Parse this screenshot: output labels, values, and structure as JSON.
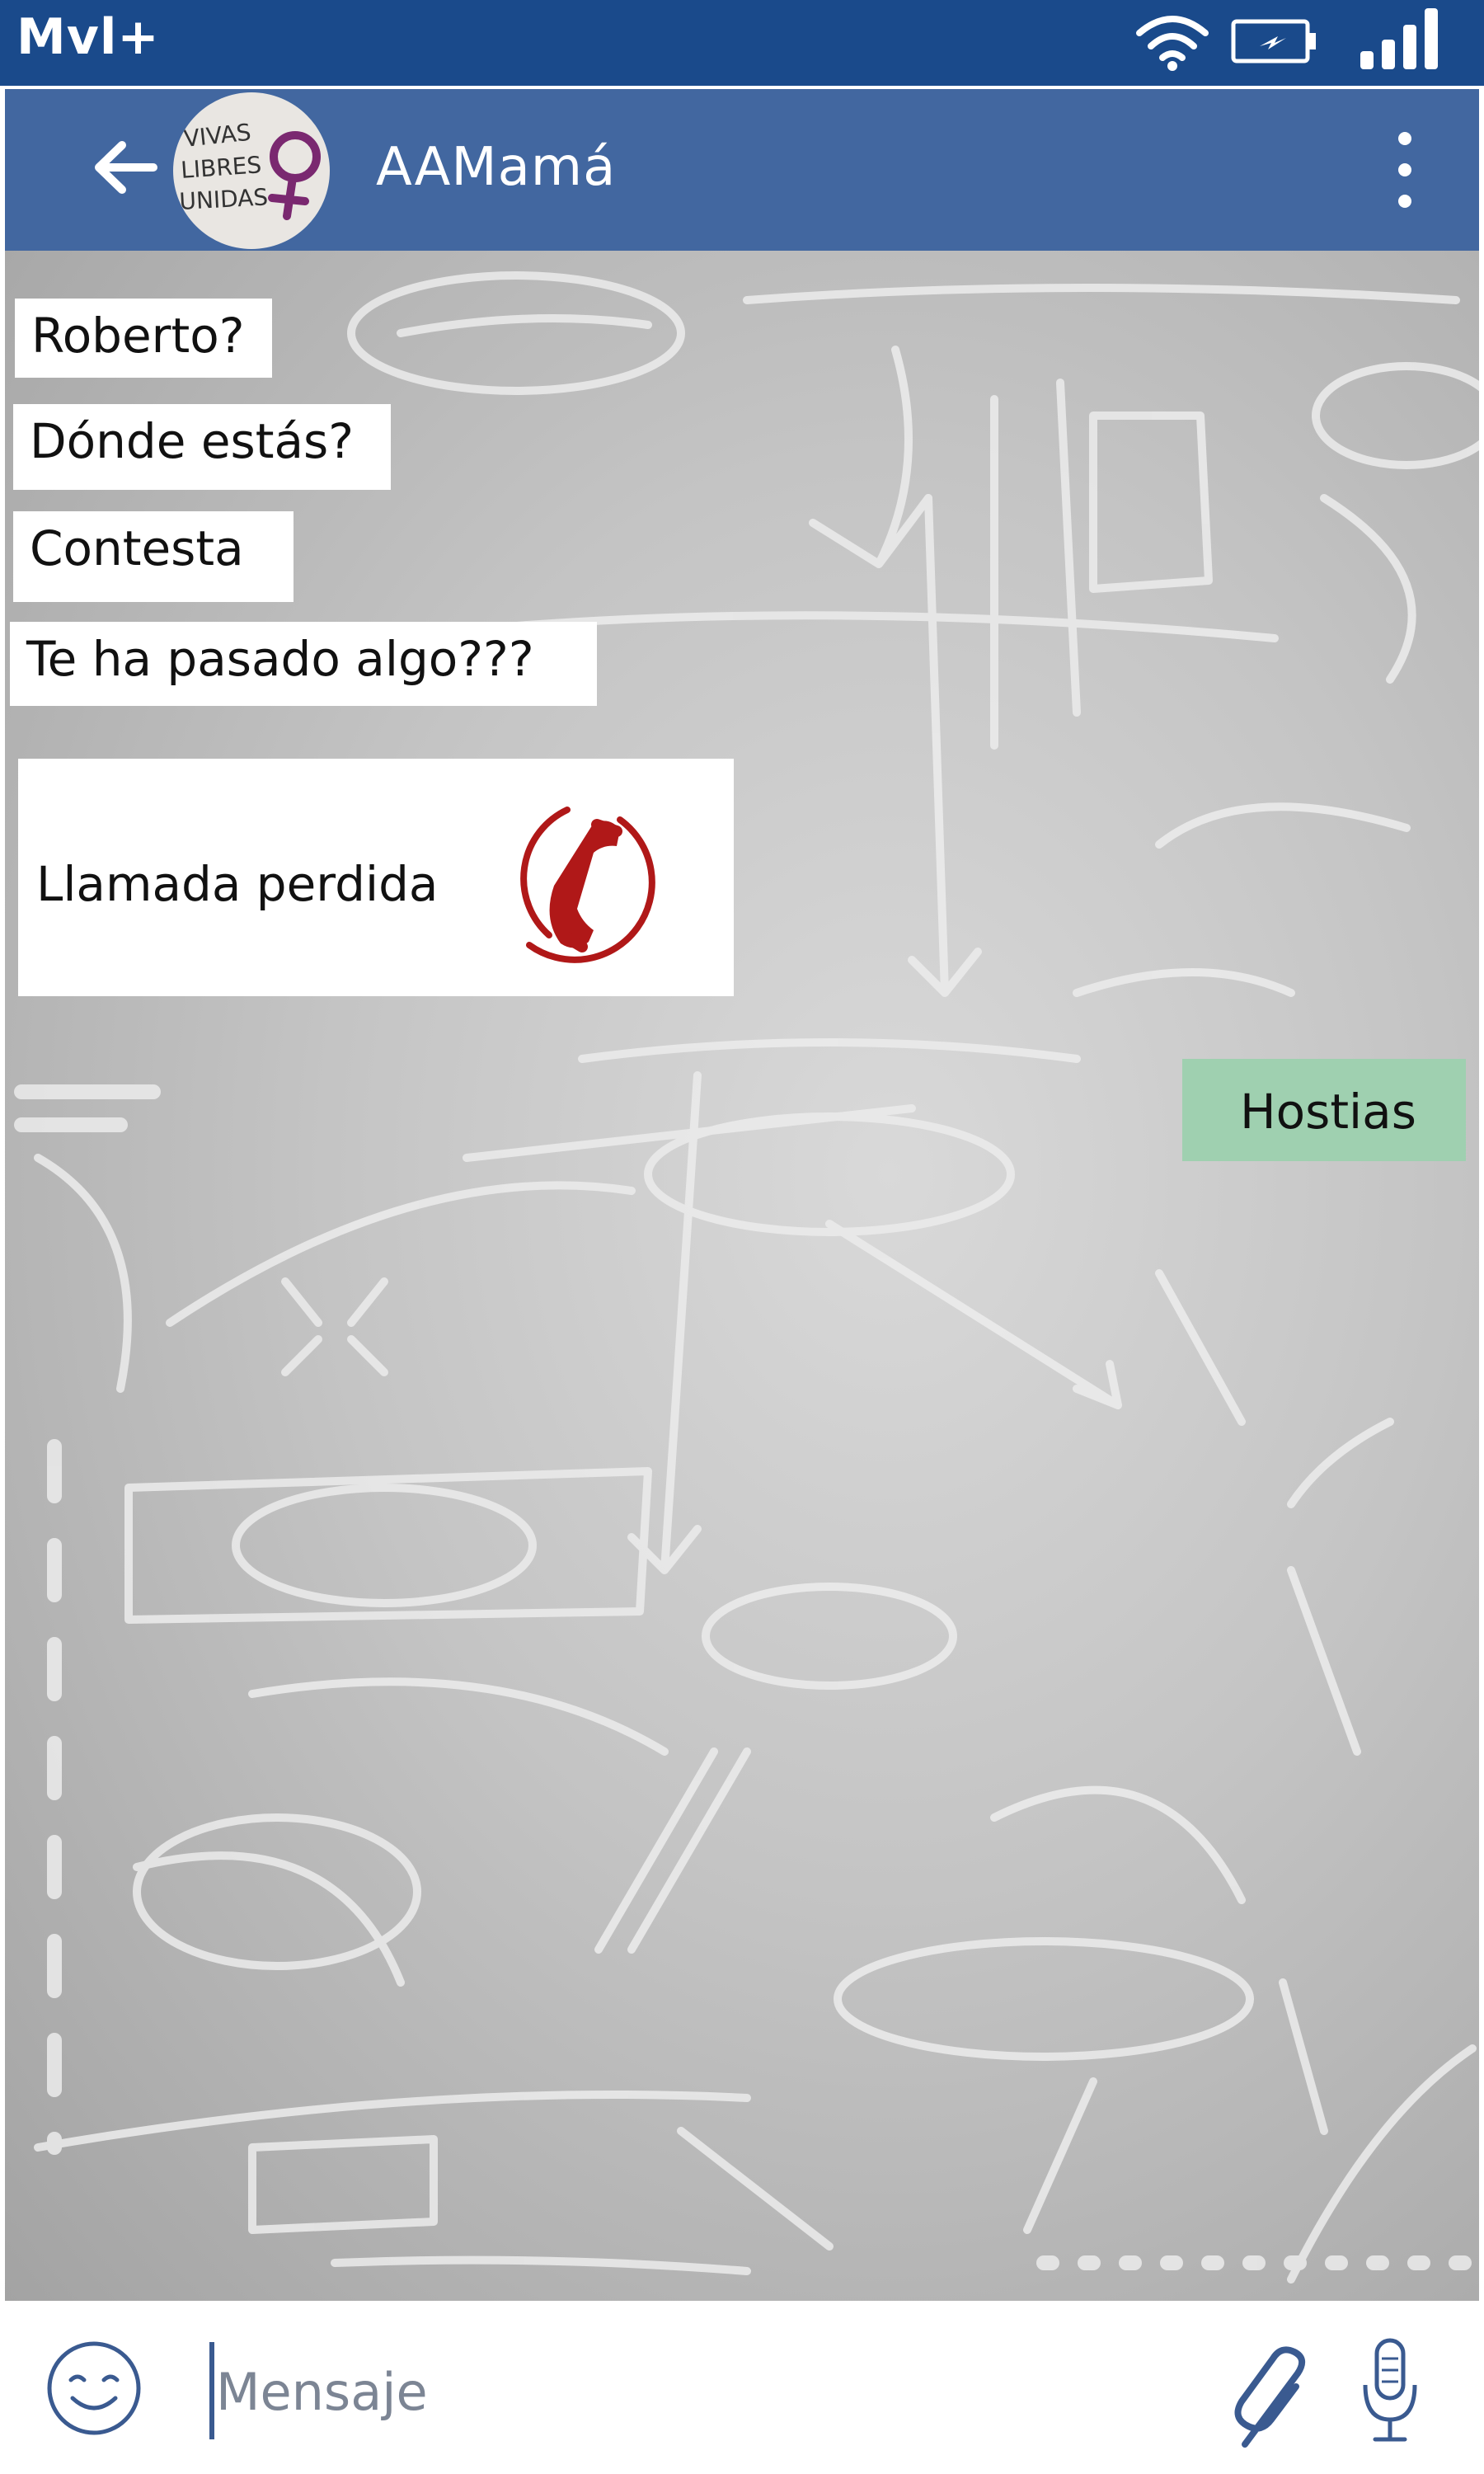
{
  "status_bar": {
    "carrier": "Mvl+",
    "icons": [
      "wifi-icon",
      "battery-charging-icon",
      "signal-icon"
    ]
  },
  "header": {
    "title": "AAMamá",
    "avatar_text": [
      "VIVAS",
      "LIBRES",
      "UNIDAS"
    ],
    "icons": [
      "back-arrow-icon",
      "more-vertical-icon"
    ]
  },
  "messages": [
    {
      "text": "Roberto?",
      "direction": "incoming"
    },
    {
      "text": "Dónde estás?",
      "direction": "incoming"
    },
    {
      "text": "Contesta",
      "direction": "incoming"
    },
    {
      "text": "Te ha pasado algo???",
      "direction": "incoming"
    },
    {
      "text": "Llamada perdida",
      "direction": "incoming",
      "icon": "missed-call-phone-icon"
    },
    {
      "text": "Hostias",
      "direction": "outgoing"
    }
  ],
  "composer": {
    "placeholder": "Mensaje",
    "icons": [
      "emoji-icon",
      "attachment-icon",
      "microphone-icon"
    ]
  },
  "colors": {
    "status_bar": "#1a4a8b",
    "app_bar": "#4267a0",
    "outgoing_bubble": "#9fd0b0",
    "incoming_bubble": "#ffffff",
    "missed_call": "#b01818",
    "avatar_symbol": "#7a2870"
  }
}
